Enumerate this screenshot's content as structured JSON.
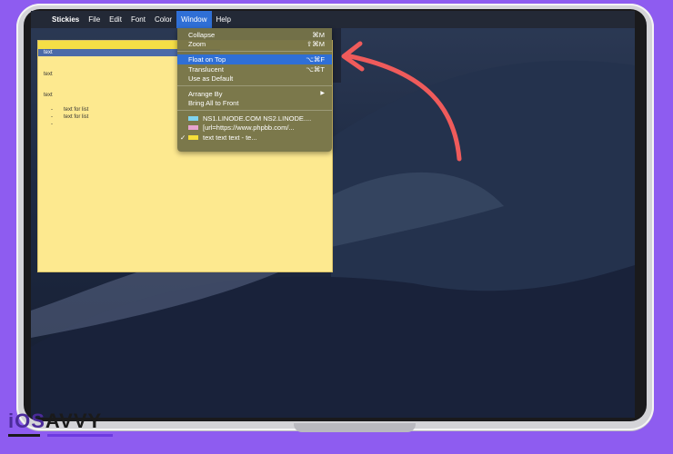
{
  "menubar": {
    "apple_icon": "apple-logo",
    "app_name": "Stickies",
    "items": [
      "File",
      "Edit",
      "Font",
      "Color",
      "Window",
      "Help"
    ],
    "active_item": "Window"
  },
  "sticky_note": {
    "lines": [
      "text",
      "text",
      "text"
    ],
    "list_items": [
      "text for list",
      "text for list",
      ""
    ],
    "bullet": "-"
  },
  "window_menu": {
    "collapse": {
      "label": "Collapse",
      "shortcut": "⌘M"
    },
    "zoom": {
      "label": "Zoom",
      "shortcut": "⇧⌘M"
    },
    "float_on_top": {
      "label": "Float on Top",
      "shortcut": "⌥⌘F"
    },
    "translucent": {
      "label": "Translucent",
      "shortcut": "⌥⌘T"
    },
    "use_as_default": {
      "label": "Use as Default"
    },
    "arrange_by": {
      "label": "Arrange By",
      "submenu_arrow": "▶"
    },
    "bring_all_to_front": {
      "label": "Bring All to Front"
    },
    "windows": [
      {
        "label": "NS1.LINODE.COM NS2.LINODE....",
        "color": "#7fd3f0",
        "checked": false
      },
      {
        "label": "[url=https://www.phpbb.com/...",
        "color": "#e6a3cf",
        "checked": false
      },
      {
        "label": "text   text    text   -      te...",
        "color": "#f5dd3a",
        "checked": true
      }
    ],
    "check_mark": "✓"
  },
  "branding": {
    "logo_part1": "iOS",
    "logo_part2": "AVVY"
  },
  "colors": {
    "accent": "#2f6fd6",
    "background": "#8e5cf0",
    "arrow": "#ef5b5b"
  }
}
